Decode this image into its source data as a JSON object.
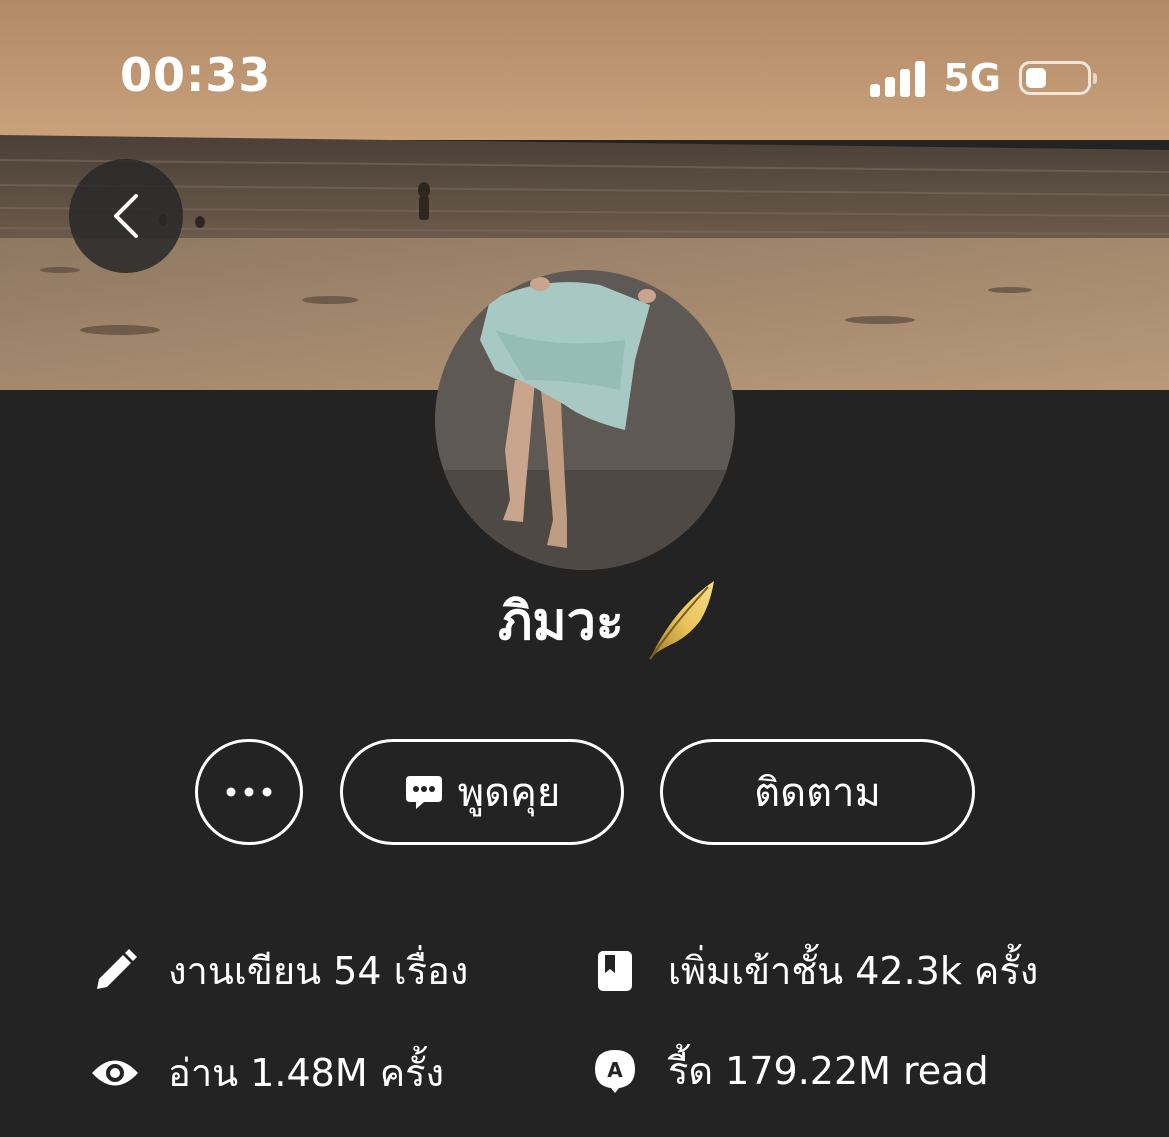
{
  "status_bar": {
    "time": "00:33",
    "network": "5G",
    "battery_level": 0.35
  },
  "profile": {
    "name": "ภิมวะ",
    "badge_icon": "gold-feather-icon"
  },
  "actions": {
    "more_icon": "ellipsis-icon",
    "chat_label": "พูดคุย",
    "chat_icon": "chat-bubble-icon",
    "follow_label": "ติดตาม"
  },
  "stats": [
    {
      "icon": "pencil-icon",
      "text": "งานเขียน 54 เรื่อง"
    },
    {
      "icon": "bookmark-icon",
      "text": "เพิ่มเข้าชั้น 42.3k ครั้ง"
    },
    {
      "icon": "eye-icon",
      "text": "อ่าน 1.48M ครั้ง"
    },
    {
      "icon": "read-badge-icon",
      "text": "รี้ด 179.22M read"
    }
  ],
  "colors": {
    "background": "#232323",
    "text": "#ffffff",
    "badge_gold": "#d9b44a"
  }
}
